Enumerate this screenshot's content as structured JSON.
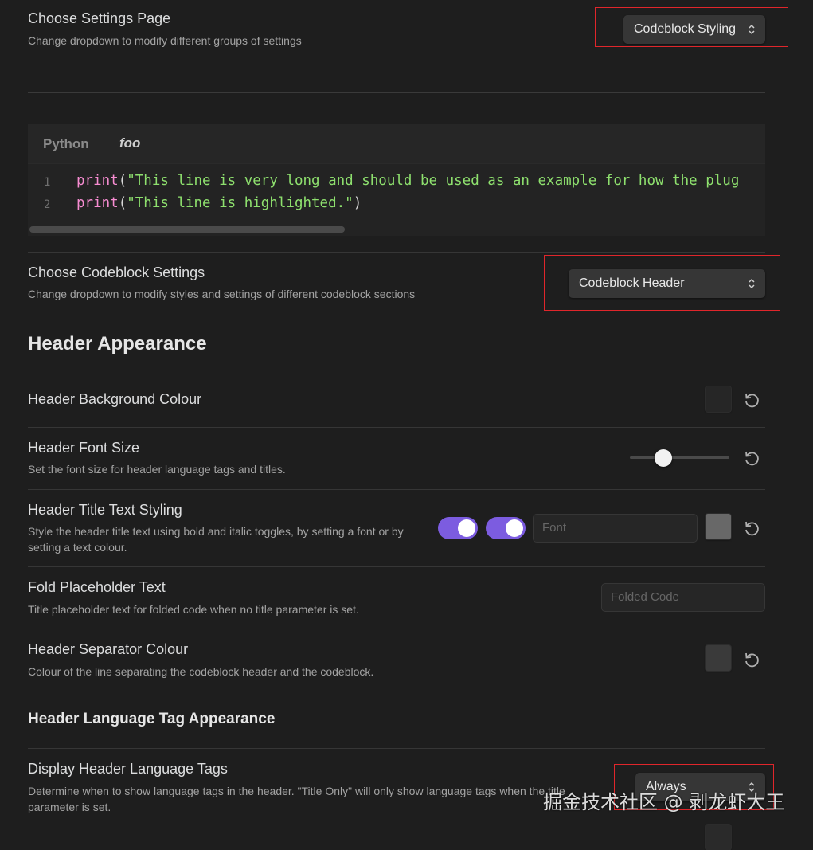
{
  "settings_page": {
    "title": "Choose Settings Page",
    "description": "Change dropdown to modify different groups of settings",
    "selected": "Codeblock Styling"
  },
  "preview": {
    "language": "Python",
    "code_title": "foo",
    "lines": [
      {
        "number": "1",
        "fn": "print",
        "open": "(",
        "string": "\"This line is very long and should be used as an example for how the plug",
        "close": ""
      },
      {
        "number": "2",
        "fn": "print",
        "open": "(",
        "string": "\"This line is highlighted.\"",
        "close": ")"
      }
    ]
  },
  "codeblock_settings": {
    "title": "Choose Codeblock Settings",
    "description": "Change dropdown to modify styles and settings of different codeblock sections",
    "selected": "Codeblock Header"
  },
  "header_appearance": {
    "heading": "Header Appearance",
    "background_colour": {
      "title": "Header Background Colour",
      "swatch": "#262626"
    },
    "font_size": {
      "title": "Header Font Size",
      "description": "Set the font size for header language tags and titles.",
      "value_fraction": 0.34
    },
    "title_text_styling": {
      "title": "Header Title Text Styling",
      "description": "Style the header title text using bold and italic toggles, by setting a font or by setting a text colour.",
      "bold_on": true,
      "italic_on": true,
      "font_placeholder": "Font",
      "swatch": "#686868"
    },
    "fold_placeholder": {
      "title": "Fold Placeholder Text",
      "description": "Title placeholder text for folded code when no title parameter is set.",
      "placeholder": "Folded Code"
    },
    "separator_colour": {
      "title": "Header Separator Colour",
      "description": "Colour of the line separating the codeblock header and the codeblock.",
      "swatch": "#3a3a3a"
    }
  },
  "language_tag_appearance": {
    "heading": "Header Language Tag Appearance",
    "display_tags": {
      "title": "Display Header Language Tags",
      "description": "Determine when to show language tags in the header. \"Title Only\" will only show language tags when the title parameter is set.",
      "selected": "Always"
    }
  },
  "watermark": "掘金技术社区 @ 剥龙虾大王",
  "colors": {
    "accent": "#7c5ce0",
    "highlight_box": "#e0262b"
  }
}
